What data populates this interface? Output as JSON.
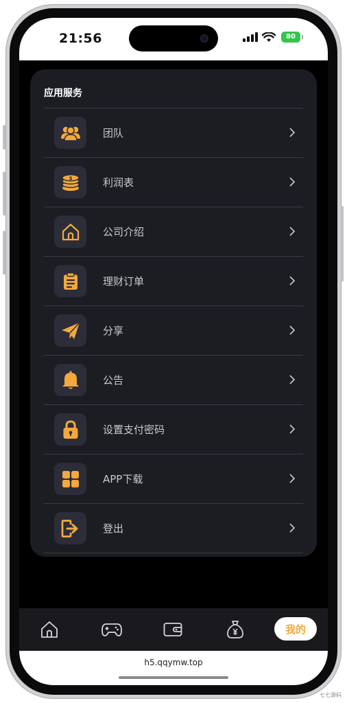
{
  "status_bar": {
    "time": "21:56",
    "battery": "80"
  },
  "section": {
    "title": "应用服务"
  },
  "menu": {
    "items": [
      {
        "label": "团队",
        "icon": "team-icon"
      },
      {
        "label": "利润表",
        "icon": "coins-icon"
      },
      {
        "label": "公司介绍",
        "icon": "home-outline-icon"
      },
      {
        "label": "理财订单",
        "icon": "clipboard-icon"
      },
      {
        "label": "分享",
        "icon": "paper-plane-icon"
      },
      {
        "label": "公告",
        "icon": "bell-icon"
      },
      {
        "label": "设置支付密码",
        "icon": "lock-icon"
      },
      {
        "label": "APP下载",
        "icon": "grid-apps-icon"
      },
      {
        "label": "登出",
        "icon": "logout-icon"
      }
    ]
  },
  "bottom_nav": {
    "active_label": "我的"
  },
  "browser": {
    "url": "h5.qqymw.top"
  },
  "watermark": "七七源码",
  "colors": {
    "accent": "#f3a93c",
    "card_bg": "#1c1d23",
    "icon_bg": "#2c2d39"
  }
}
